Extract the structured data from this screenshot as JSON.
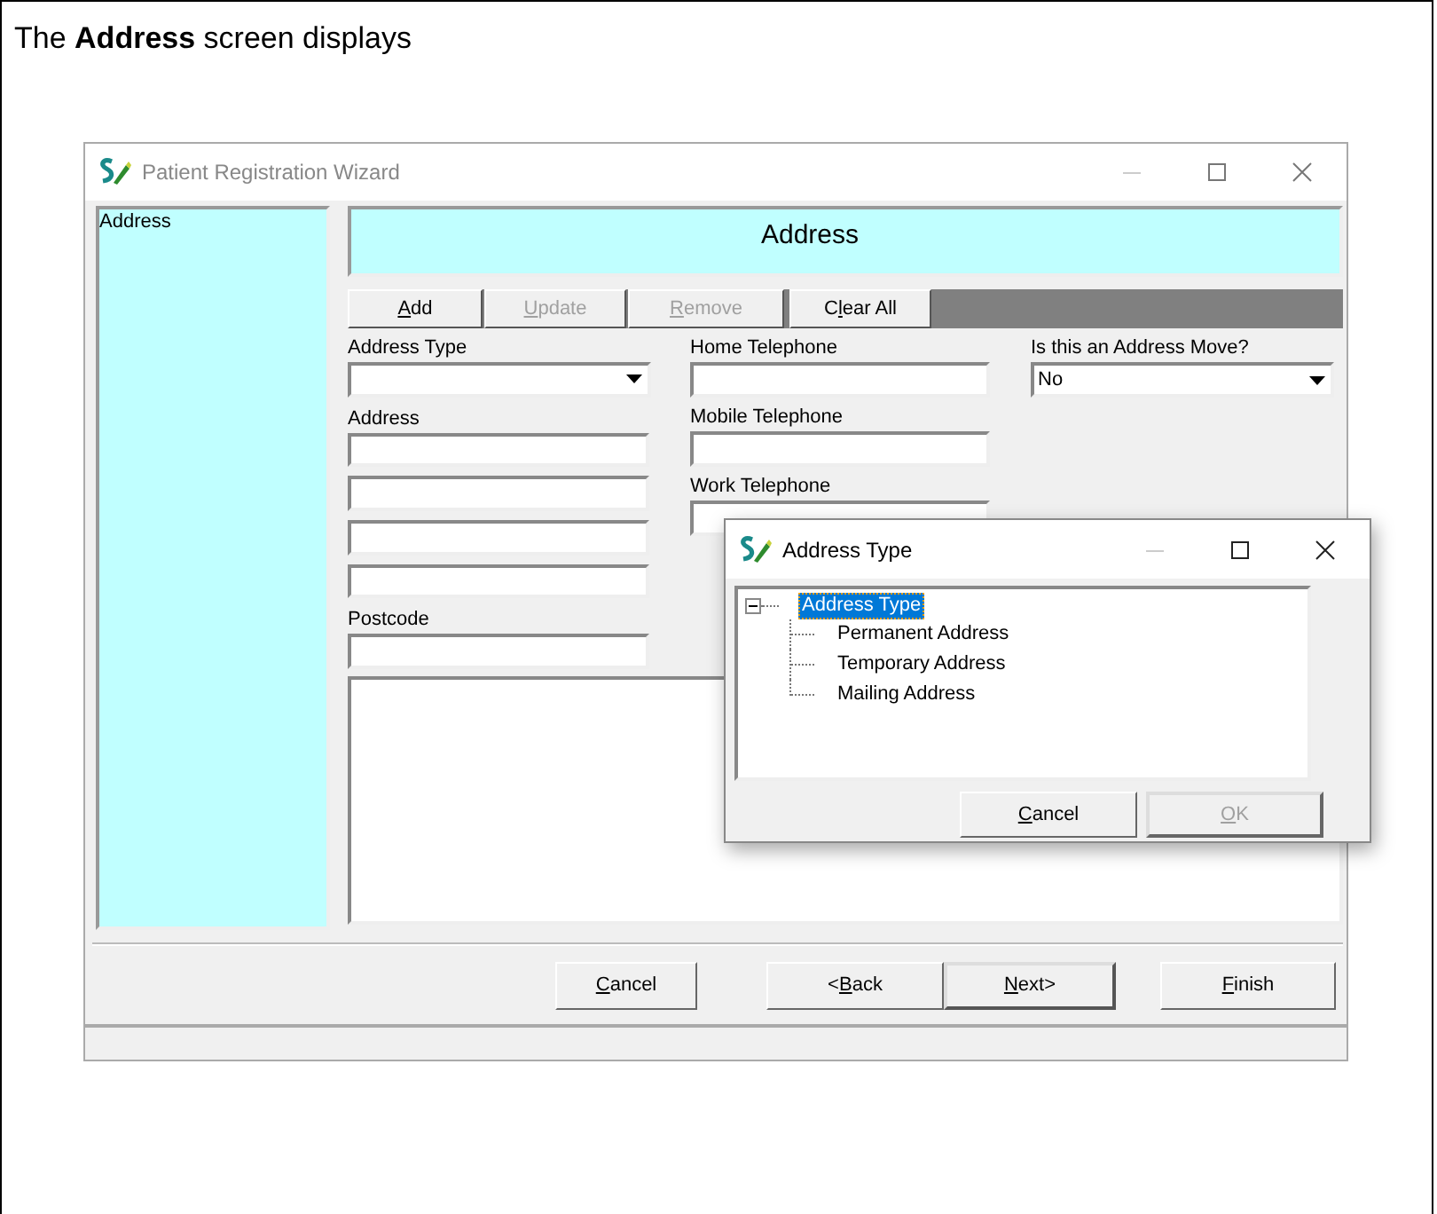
{
  "caption": "The **Address** screen displays",
  "window": {
    "title": "Patient Registration Wizard"
  },
  "sidebar": {
    "items": [
      "Address"
    ]
  },
  "header": "Address",
  "toolbar": [
    {
      "parts": [
        {
          "text": "A",
          "underline": true
        },
        {
          "text": "dd",
          "underline": false
        }
      ],
      "disabled": false
    },
    {
      "parts": [
        {
          "text": "U",
          "underline": true
        },
        {
          "text": "pdate",
          "underline": false
        }
      ],
      "disabled": true
    },
    {
      "parts": [
        {
          "text": "R",
          "underline": true
        },
        {
          "text": "emove",
          "underline": false
        }
      ],
      "disabled": true
    },
    {
      "parts": [
        {
          "text": "C",
          "underline": false
        },
        {
          "text": "l",
          "underline": true
        },
        {
          "text": "ear All",
          "underline": false
        }
      ],
      "disabled": false
    }
  ],
  "fields": {
    "address_type": {
      "label": "Address Type"
    },
    "address": {
      "label": "Address"
    },
    "postcode": {
      "label": "Postcode"
    },
    "home_telephone": {
      "label": "Home Telephone"
    },
    "mobile_telephone": {
      "label": "Mobile Telephone"
    },
    "work_telephone": {
      "label": "Work Telephone"
    },
    "address_move": {
      "label": "Is this an Address Move?",
      "value": "No"
    }
  },
  "buttons": [
    {
      "parts": [
        {
          "text": "C",
          "underline": true
        },
        {
          "text": "ancel",
          "underline": false
        }
      ],
      "default": false
    },
    {
      "parts": [
        {
          "text": "<",
          "underline": false
        },
        {
          "text": "B",
          "underline": true
        },
        {
          "text": "ack",
          "underline": false
        }
      ],
      "default": false
    },
    {
      "parts": [
        {
          "text": "N",
          "underline": true
        },
        {
          "text": "ext>",
          "underline": false
        }
      ],
      "default": true
    },
    {
      "parts": [
        {
          "text": "F",
          "underline": true
        },
        {
          "text": "inish",
          "underline": false
        }
      ],
      "default": false
    }
  ],
  "dialog": {
    "title": "Address Type",
    "tree": {
      "label": "Address Type",
      "selected": true,
      "expanded": true,
      "children": [
        {
          "label": "Permanent Address",
          "selected": false
        },
        {
          "label": "Temporary Address",
          "selected": false
        },
        {
          "label": "Mailing Address",
          "selected": false
        }
      ]
    },
    "buttons": [
      {
        "parts": [
          {
            "text": "C",
            "underline": true
          },
          {
            "text": "ancel",
            "underline": false
          }
        ],
        "disabled": false
      },
      {
        "parts": [
          {
            "text": "O",
            "underline": true
          },
          {
            "text": "K",
            "underline": false
          }
        ],
        "disabled": true
      }
    ]
  }
}
